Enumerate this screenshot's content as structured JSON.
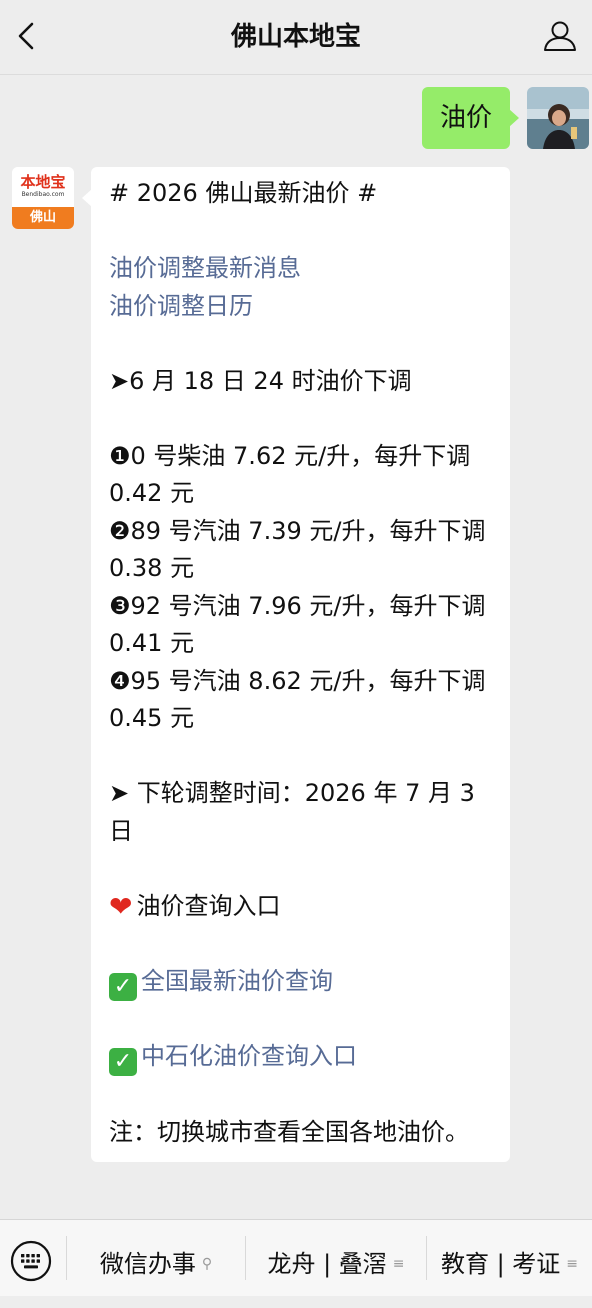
{
  "header": {
    "title": "佛山本地宝",
    "back_icon": "chevron-left-icon",
    "profile_icon": "person-icon"
  },
  "user_message": {
    "text": "油价",
    "bubble_color": "#95ec69"
  },
  "bot_avatar": {
    "brand": "本地宝",
    "url": "Bendibao.com",
    "city": "佛山"
  },
  "bot_message": {
    "heading": "# 2026 佛山最新油价 #",
    "link_1": "油价调整最新消息",
    "link_2": "油价调整日历",
    "adjust_note": "➤6 月 18 日 24 时油价下调",
    "prices": [
      {
        "marker": "❶",
        "text": "0 号柴油 7.62 元/升，每升下调",
        "change": "0.42 元"
      },
      {
        "marker": "❷",
        "text": "89 号汽油 7.39 元/升，每升下调",
        "change": "0.38 元"
      },
      {
        "marker": "❸",
        "text": "92 号汽油 7.96 元/升，每升下调",
        "change": "0.41 元"
      },
      {
        "marker": "❹",
        "text": "95 号汽油 8.62 元/升，每升下调",
        "change": "0.45 元"
      }
    ],
    "next_adjust_line1": "➤ 下轮调整时间：2026 年 7 月 3",
    "next_adjust_line2": "日",
    "query_title": "油价查询入口",
    "query_link_1": "全国最新油价查询",
    "query_link_2": "中石化油价查询入口",
    "footnote": "注：切换城市查看全国各地油价。",
    "link_color": "#576b95"
  },
  "bottom_menu": {
    "keyboard_icon": "keyboard-icon",
    "items": [
      {
        "label": "微信办事",
        "suffix": "⚲"
      },
      {
        "label": "龙舟 | 叠滘",
        "suffix": "≡"
      },
      {
        "label": "教育 | 考证",
        "suffix": "≡"
      }
    ]
  }
}
